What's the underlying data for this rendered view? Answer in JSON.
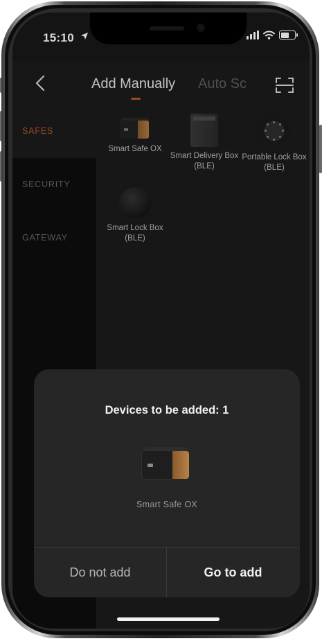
{
  "status_bar": {
    "time": "15:10"
  },
  "header": {
    "tab_active": "Add Manually",
    "tab_inactive": "Auto Sc"
  },
  "sidebar": {
    "items": [
      {
        "label": "SAFES",
        "active": true
      },
      {
        "label": "SECURITY",
        "active": false
      },
      {
        "label": "GATEWAY",
        "active": false
      }
    ]
  },
  "devices": [
    {
      "label": "Smart Safe OX"
    },
    {
      "label": "Smart Delivery Box (BLE)"
    },
    {
      "label": "Portable Lock Box (BLE)"
    },
    {
      "label": "Smart Lock Box (BLE)"
    }
  ],
  "dialog": {
    "title": "Devices to be added: 1",
    "device_label": "Smart Safe OX",
    "cancel_label": "Do not add",
    "confirm_label": "Go to add"
  },
  "colors": {
    "accent": "#b5552a",
    "background": "#1c1c1c",
    "sidebar": "#0e0e0e"
  }
}
